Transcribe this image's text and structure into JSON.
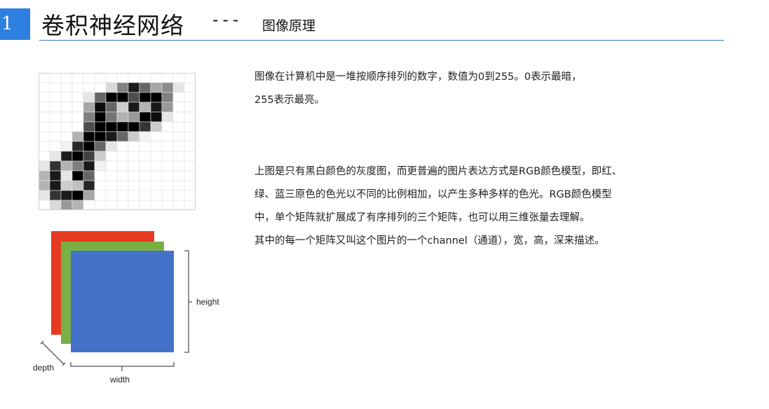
{
  "header": {
    "page_number": "1",
    "title": "卷积神经网络",
    "separator": "---",
    "subtitle": "图像原理"
  },
  "gray_image": {
    "rows": [
      [
        0,
        0,
        0,
        0,
        0,
        0,
        0,
        0,
        0,
        0,
        0,
        0,
        0,
        0
      ],
      [
        0,
        0,
        0,
        0,
        0,
        0,
        0.15,
        0.5,
        0.9,
        0.6,
        0.35,
        0.45,
        0.1,
        0
      ],
      [
        0,
        0,
        0,
        0,
        0.1,
        0.6,
        1,
        1,
        0.7,
        1,
        1,
        0.5,
        0,
        0
      ],
      [
        0,
        0,
        0,
        0,
        0.35,
        0.95,
        0.6,
        0.2,
        0.9,
        0.3,
        0.9,
        0.4,
        0,
        0
      ],
      [
        0,
        0,
        0,
        0,
        0.5,
        1,
        0.55,
        0.3,
        0.4,
        1,
        0.95,
        0.1,
        0,
        0
      ],
      [
        0,
        0,
        0,
        0,
        0.7,
        1,
        1,
        1,
        1,
        0.8,
        0.2,
        0,
        0,
        0
      ],
      [
        0,
        0,
        0,
        0.3,
        1,
        1,
        0.9,
        0.6,
        0.2,
        0.05,
        0,
        0,
        0,
        0
      ],
      [
        0,
        0,
        0.05,
        0.85,
        1,
        0.6,
        0.1,
        0,
        0,
        0,
        0,
        0,
        0,
        0
      ],
      [
        0,
        0.1,
        0.9,
        1,
        0.75,
        0.2,
        0,
        0,
        0,
        0,
        0,
        0,
        0,
        0
      ],
      [
        0.1,
        0.8,
        0.3,
        0.5,
        0.9,
        0.05,
        0,
        0,
        0,
        0,
        0,
        0,
        0,
        0
      ],
      [
        0.3,
        0.9,
        0.1,
        1,
        0.6,
        0,
        0,
        0,
        0,
        0,
        0,
        0,
        0,
        0
      ],
      [
        0.3,
        0.9,
        0.2,
        0.25,
        0.85,
        0,
        0,
        0,
        0,
        0,
        0,
        0,
        0,
        0
      ],
      [
        0.1,
        0.8,
        0.9,
        1,
        0.35,
        0,
        0,
        0,
        0,
        0,
        0,
        0,
        0,
        0
      ],
      [
        0,
        0.15,
        0.4,
        0.3,
        0,
        0,
        0,
        0,
        0,
        0,
        0,
        0,
        0,
        0
      ]
    ]
  },
  "rgb_diagram": {
    "colors": {
      "red": "#e63a22",
      "green": "#78b043",
      "blue": "#4472c8",
      "bracket": "#555555"
    },
    "labels": {
      "height": "height",
      "width": "width",
      "depth": "depth"
    }
  },
  "paragraph1": {
    "line1": "图像在计算机中是一堆按顺序排列的数字，数值为0到255。0表示最暗，",
    "line2": "255表示最亮。"
  },
  "paragraph2": {
    "line1": "上图是只有黑白颜色的灰度图，而更普遍的图片表达方式是RGB颜色模型，即红、",
    "line2": "绿、蓝三原色的色光以不同的比例相加，以产生多种多样的色光。RGB颜色模型",
    "line3": "中，单个矩阵就扩展成了有序排列的三个矩阵，也可以用三维张量去理解。",
    "line4": "其中的每一个矩阵又叫这个图片的一个channel（通道），宽，高，深来描述。"
  }
}
